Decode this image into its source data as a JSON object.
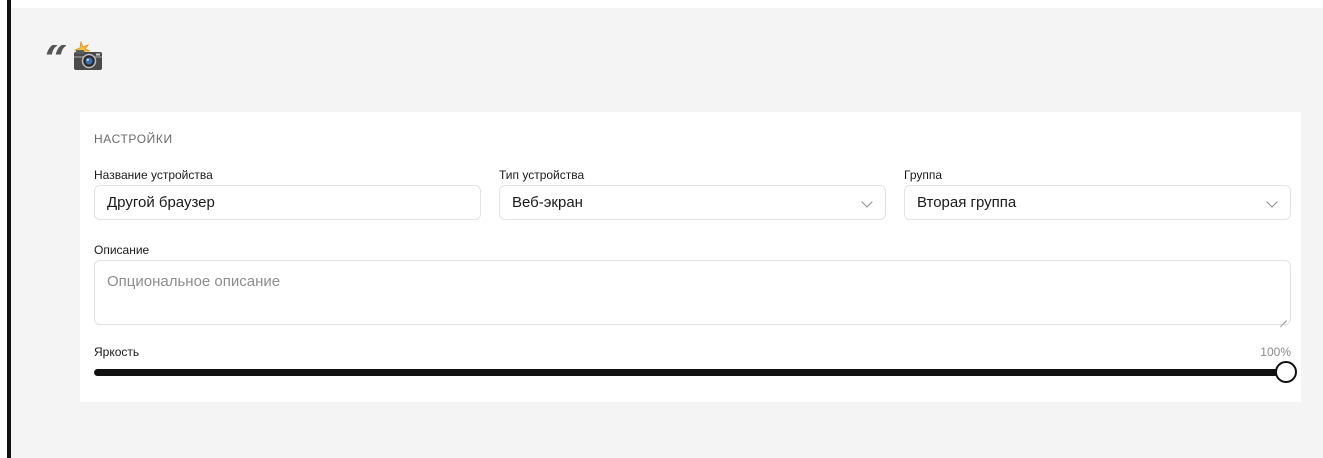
{
  "header": {
    "quote_icon": "quote-icon",
    "camera_icon": "camera-with-flash-icon"
  },
  "settings": {
    "section_title": "НАСТРОЙКИ",
    "device_name": {
      "label": "Название устройства",
      "value": "Другой браузер"
    },
    "device_type": {
      "label": "Тип устройства",
      "selected": "Веб-экран"
    },
    "group": {
      "label": "Группа",
      "selected": "Вторая группа"
    },
    "description": {
      "label": "Описание",
      "placeholder": "Опциональное описание"
    },
    "brightness": {
      "label": "Яркость",
      "value_text": "100%",
      "value": 100
    }
  }
}
